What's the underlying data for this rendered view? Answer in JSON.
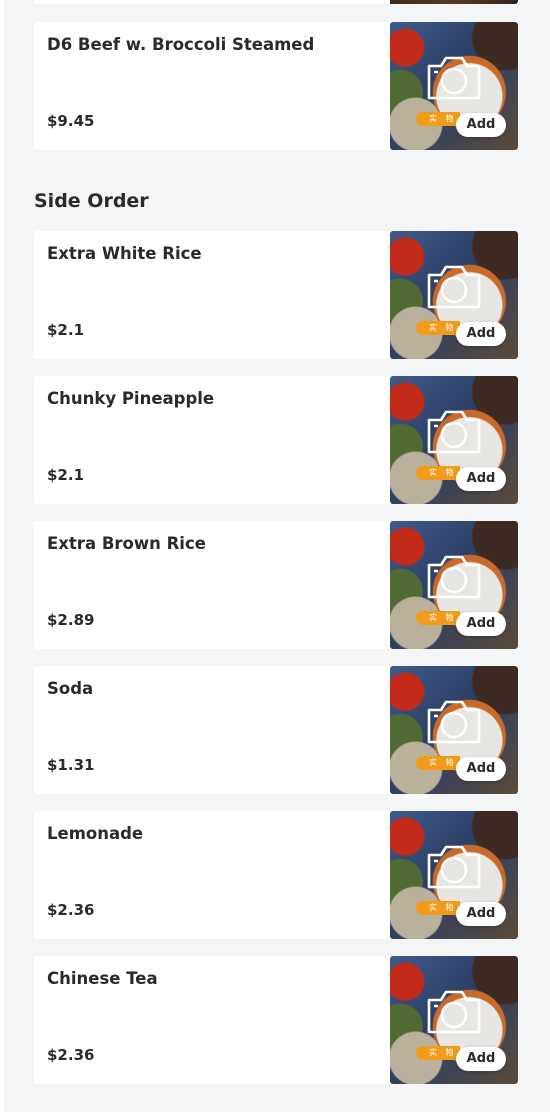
{
  "sections": [
    {
      "title": "",
      "items": [
        {
          "name": "D6 Beef w. Broccoli Steamed",
          "price": "$9.45",
          "add_label": "Add",
          "badge": "实 物"
        }
      ]
    },
    {
      "title": "Side Order",
      "items": [
        {
          "name": "Extra White Rice",
          "price": "$2.1",
          "add_label": "Add",
          "badge": "实 物"
        },
        {
          "name": "Chunky Pineapple",
          "price": "$2.1",
          "add_label": "Add",
          "badge": "实 物"
        },
        {
          "name": "Extra Brown Rice",
          "price": "$2.89",
          "add_label": "Add",
          "badge": "实 物"
        },
        {
          "name": "Soda",
          "price": "$1.31",
          "add_label": "Add",
          "badge": "实 物"
        },
        {
          "name": "Lemonade",
          "price": "$2.36",
          "add_label": "Add",
          "badge": "实 物"
        },
        {
          "name": "Chinese Tea",
          "price": "$2.36",
          "add_label": "Add",
          "badge": "实 物"
        }
      ]
    }
  ],
  "icons": {
    "thumbnail_placeholder": "camera-icon"
  },
  "colors": {
    "page_background": "#f4f5f7",
    "card_background": "#ffffff",
    "badge": "#f29b1a",
    "text": "#2a2a2a"
  }
}
